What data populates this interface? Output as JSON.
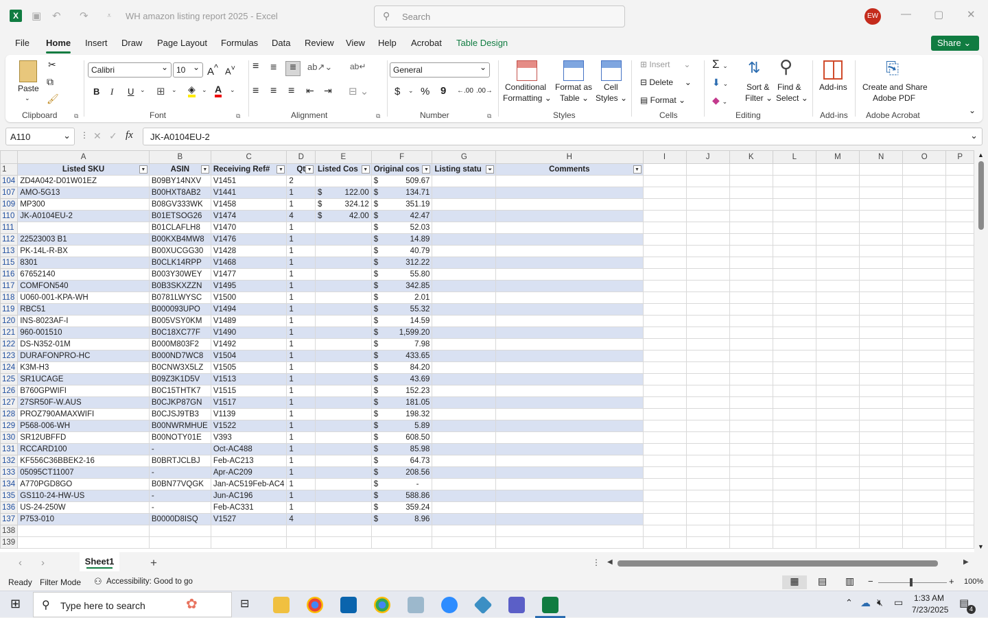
{
  "app": {
    "title": "WH amazon listing report 2025  -  Excel",
    "search_placeholder": "Search",
    "user_initials": "EW"
  },
  "menu": {
    "items": [
      "File",
      "Home",
      "Insert",
      "Draw",
      "Page Layout",
      "Formulas",
      "Data",
      "Review",
      "View",
      "Help",
      "Acrobat",
      "Table Design"
    ],
    "share_label": "Share"
  },
  "ribbon": {
    "paste": "Paste",
    "clipboard": "Clipboard",
    "font_name": "Calibri",
    "font_size": "10",
    "font": "Font",
    "bold": "B",
    "italic": "I",
    "underline": "U",
    "alignment": "Alignment",
    "number_format": "General",
    "number": "Number",
    "currency": "$",
    "percent": "%",
    "comma": "9",
    "conditional": "Conditional",
    "formatting": "Formatting",
    "format_as": "Format as",
    "table": "Table",
    "cell": "Cell",
    "styles_btn": "Styles",
    "styles": "Styles",
    "insert": "Insert",
    "delete": "Delete",
    "format": "Format",
    "cells": "Cells",
    "sort": "Sort &",
    "filter": "Filter",
    "find": "Find &",
    "select": "Select",
    "editing": "Editing",
    "addins_btn": "Add-ins",
    "addins": "Add-ins",
    "create_share": "Create and Share",
    "adobe_pdf": "Adobe PDF",
    "adobe_acrobat": "Adobe Acrobat"
  },
  "formula_bar": {
    "cell_ref": "A110",
    "content": "JK-A0104EU-2",
    "fx": "fx"
  },
  "columns": [
    "A",
    "B",
    "C",
    "D",
    "E",
    "F",
    "G",
    "H",
    "I",
    "J",
    "K",
    "L",
    "M",
    "N",
    "O",
    "P"
  ],
  "table_headers": [
    "Listed SKU",
    "ASIN",
    "Receiving Ref#",
    "Qt",
    "Listed Cos",
    "Original cos",
    "Listing statu",
    "Comments"
  ],
  "rows": [
    {
      "r": "104",
      "a": "ZD4A042-D01W01EZ",
      "b": "B09BY14NXV",
      "c": "V1451",
      "d": "2",
      "e": "",
      "f": "509.67"
    },
    {
      "r": "107",
      "a": "AMO-5G13",
      "b": "B00HXT8AB2",
      "c": "V1441",
      "d": "1",
      "e": "122.00",
      "f": "134.71"
    },
    {
      "r": "109",
      "a": "MP300",
      "b": "B08GV333WK",
      "c": "V1458",
      "d": "1",
      "e": "324.12",
      "f": "351.19"
    },
    {
      "r": "110",
      "a": "JK-A0104EU-2",
      "b": "B01ETSOG26",
      "c": "V1474",
      "d": "4",
      "e": "42.00",
      "f": "42.47"
    },
    {
      "r": "111",
      "a": "",
      "b": "B01CLAFLH8",
      "c": "V1470",
      "d": "1",
      "e": "",
      "f": "52.03"
    },
    {
      "r": "112",
      "a": "22523003 B1",
      "b": "B00KXB4MW8",
      "c": "V1476",
      "d": "1",
      "e": "",
      "f": "14.89"
    },
    {
      "r": "113",
      "a": "PK-14L-R-BX",
      "b": "B00XUCGG30",
      "c": "V1428",
      "d": "1",
      "e": "",
      "f": "40.79"
    },
    {
      "r": "115",
      "a": "8301",
      "b": "B0CLK14RPP",
      "c": "V1468",
      "d": "1",
      "e": "",
      "f": "312.22"
    },
    {
      "r": "116",
      "a": "67652140",
      "b": "B003Y30WEY",
      "c": "V1477",
      "d": "1",
      "e": "",
      "f": "55.80"
    },
    {
      "r": "117",
      "a": "COMFON540",
      "b": "B0B3SKXZZN",
      "c": "V1495",
      "d": "1",
      "e": "",
      "f": "342.85"
    },
    {
      "r": "118",
      "a": "U060-001-KPA-WH",
      "b": "B0781LWYSC",
      "c": "V1500",
      "d": "1",
      "e": "",
      "f": "2.01"
    },
    {
      "r": "119",
      "a": "RBC51",
      "b": "B000093UPO",
      "c": "V1494",
      "d": "1",
      "e": "",
      "f": "55.32"
    },
    {
      "r": "120",
      "a": "INS-8023AF-I",
      "b": "B005VSY0KM",
      "c": "V1489",
      "d": "1",
      "e": "",
      "f": "14.59"
    },
    {
      "r": "121",
      "a": "960-001510",
      "b": "B0C18XC77F",
      "c": "V1490",
      "d": "1",
      "e": "",
      "f": "1,599.20"
    },
    {
      "r": "122",
      "a": "DS-N352-01M",
      "b": "B000M803F2",
      "c": "V1492",
      "d": "1",
      "e": "",
      "f": "7.98"
    },
    {
      "r": "123",
      "a": "DURAFONPRO-HC",
      "b": "B000ND7WC8",
      "c": "V1504",
      "d": "1",
      "e": "",
      "f": "433.65"
    },
    {
      "r": "124",
      "a": "K3M-H3",
      "b": "B0CNW3X5LZ",
      "c": "V1505",
      "d": "1",
      "e": "",
      "f": "84.20"
    },
    {
      "r": "125",
      "a": "SR1UCAGE",
      "b": "B09Z3K1D5V",
      "c": "V1513",
      "d": "1",
      "e": "",
      "f": "43.69"
    },
    {
      "r": "126",
      "a": "B760GPWIFI",
      "b": "B0C15THTK7",
      "c": "V1515",
      "d": "1",
      "e": "",
      "f": "152.23"
    },
    {
      "r": "127",
      "a": "27SR50F-W.AUS",
      "b": "B0CJKP87GN",
      "c": "V1517",
      "d": "1",
      "e": "",
      "f": "181.05"
    },
    {
      "r": "128",
      "a": "PROZ790AMAXWIFI",
      "b": "B0CJSJ9TB3",
      "c": "V1139",
      "d": "1",
      "e": "",
      "f": "198.32"
    },
    {
      "r": "129",
      "a": "P568-006-WH",
      "b": "B00NWRMHUE",
      "c": "V1522",
      "d": "1",
      "e": "",
      "f": "5.89"
    },
    {
      "r": "130",
      "a": "SR12UBFFD",
      "b": "B00NOTY01E",
      "c": "V393",
      "d": "1",
      "e": "",
      "f": "608.50"
    },
    {
      "r": "131",
      "a": "RCCARD100",
      "b": "-",
      "c": "Oct-AC488",
      "d": "1",
      "e": "",
      "f": "85.98"
    },
    {
      "r": "132",
      "a": "KF556C36BBEK2-16",
      "b": "B0BRTJCLBJ",
      "c": "Feb-AC213",
      "d": "1",
      "e": "",
      "f": "64.73"
    },
    {
      "r": "133",
      "a": "05095CT11007",
      "b": "-",
      "c": "Apr-AC209",
      "d": "1",
      "e": "",
      "f": "208.56"
    },
    {
      "r": "134",
      "a": "A770PGD8GO",
      "b": "B0BN77VQGK",
      "c": "Jan-AC519Feb-AC4",
      "d": "1",
      "e": "",
      "f": "-"
    },
    {
      "r": "135",
      "a": "GS110-24-HW-US",
      "b": "-",
      "c": "Jun-AC196",
      "d": "1",
      "e": "",
      "f": "588.86"
    },
    {
      "r": "136",
      "a": "US-24-250W",
      "b": "-",
      "c": "Feb-AC331",
      "d": "1",
      "e": "",
      "f": "359.24"
    },
    {
      "r": "137",
      "a": "P753-010",
      "b": "B0000D8ISQ",
      "c": "V1527",
      "d": "4",
      "e": "",
      "f": "8.96"
    }
  ],
  "empty_rows": [
    "138",
    "139"
  ],
  "currency_symbol": "$",
  "sheet_tab": "Sheet1",
  "status": {
    "ready": "Ready",
    "filter_mode": "Filter Mode",
    "accessibility": "Accessibility: Good to go",
    "zoom": "100%"
  },
  "taskbar": {
    "search_placeholder": "Type here to search",
    "time": "1:33 AM",
    "date": "7/23/2025",
    "notif_count": "4"
  }
}
